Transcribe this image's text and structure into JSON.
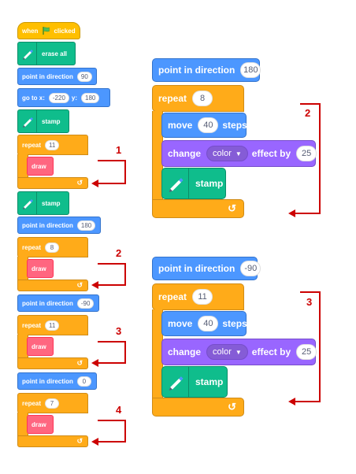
{
  "left_stack": {
    "when_clicked": {
      "prefix": "when",
      "flag_icon": "green-flag-icon",
      "suffix": "clicked"
    },
    "erase_all": "erase all",
    "point_direction_1": {
      "label": "point in direction",
      "value": "90"
    },
    "goto": {
      "label_x": "go to x:",
      "x": "-220",
      "label_y": "y:",
      "y": "180"
    },
    "stamp_1": "stamp",
    "repeat_1": {
      "label": "repeat",
      "value": "11",
      "inner": "draw"
    },
    "stamp_2": "stamp",
    "point_direction_2": {
      "label": "point in direction",
      "value": "180"
    },
    "repeat_2": {
      "label": "repeat",
      "value": "8",
      "inner": "draw"
    },
    "point_direction_3": {
      "label": "point in direction",
      "value": "-90"
    },
    "repeat_3": {
      "label": "repeat",
      "value": "11",
      "inner": "draw"
    },
    "point_direction_4": {
      "label": "point in direction",
      "value": "0"
    },
    "repeat_4": {
      "label": "repeat",
      "value": "7",
      "inner": "draw"
    }
  },
  "script_2": {
    "point_direction": {
      "label": "point in direction",
      "value": "180"
    },
    "repeat": {
      "label": "repeat",
      "value": "8"
    },
    "move": {
      "label": "move",
      "value": "40",
      "suffix": "steps"
    },
    "change": {
      "label": "change",
      "effect": "color",
      "mid": "effect by",
      "value": "25"
    },
    "stamp": "stamp"
  },
  "script_3": {
    "point_direction": {
      "label": "point in direction",
      "value": "-90"
    },
    "repeat": {
      "label": "repeat",
      "value": "11"
    },
    "move": {
      "label": "move",
      "value": "40",
      "suffix": "steps"
    },
    "change": {
      "label": "change",
      "effect": "color",
      "mid": "effect by",
      "value": "25"
    },
    "stamp": "stamp"
  },
  "annotations": {
    "n1": "1",
    "n2": "2",
    "n3": "3",
    "n4": "4",
    "m2": "2",
    "m3": "3"
  },
  "colors": {
    "events": "#ffbf00",
    "control": "#ffab19",
    "motion": "#4c97ff",
    "pen": "#0fbd8c",
    "looks": "#9966ff",
    "custom": "#ff6680",
    "arrow": "#cc0000"
  }
}
